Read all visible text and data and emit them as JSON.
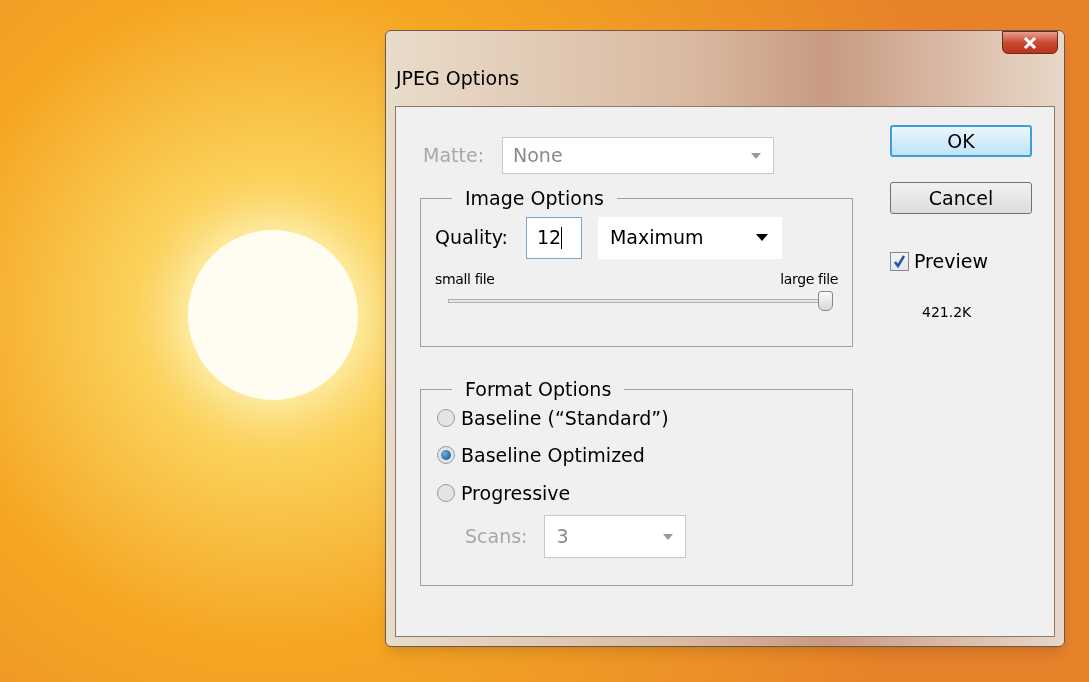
{
  "window": {
    "title": "JPEG Options"
  },
  "matte": {
    "label": "Matte:",
    "value": "None",
    "disabled": true
  },
  "image_options": {
    "title": "Image Options",
    "quality_label": "Quality:",
    "quality_value": "12",
    "quality_preset": "Maximum",
    "slider": {
      "min_label": "small file",
      "max_label": "large file",
      "level": 1.0
    }
  },
  "format_options": {
    "title": "Format Options",
    "options": [
      {
        "label": "Baseline (“Standard”)",
        "selected": false
      },
      {
        "label": "Baseline Optimized",
        "selected": true
      },
      {
        "label": "Progressive",
        "selected": false
      }
    ],
    "scans": {
      "label": "Scans:",
      "value": "3",
      "disabled": true
    }
  },
  "buttons": [
    {
      "label": "OK",
      "default": true
    },
    {
      "label": "Cancel",
      "default": false
    }
  ],
  "preview": {
    "label": "Preview",
    "checked": true
  },
  "file_size": "421.2K"
}
